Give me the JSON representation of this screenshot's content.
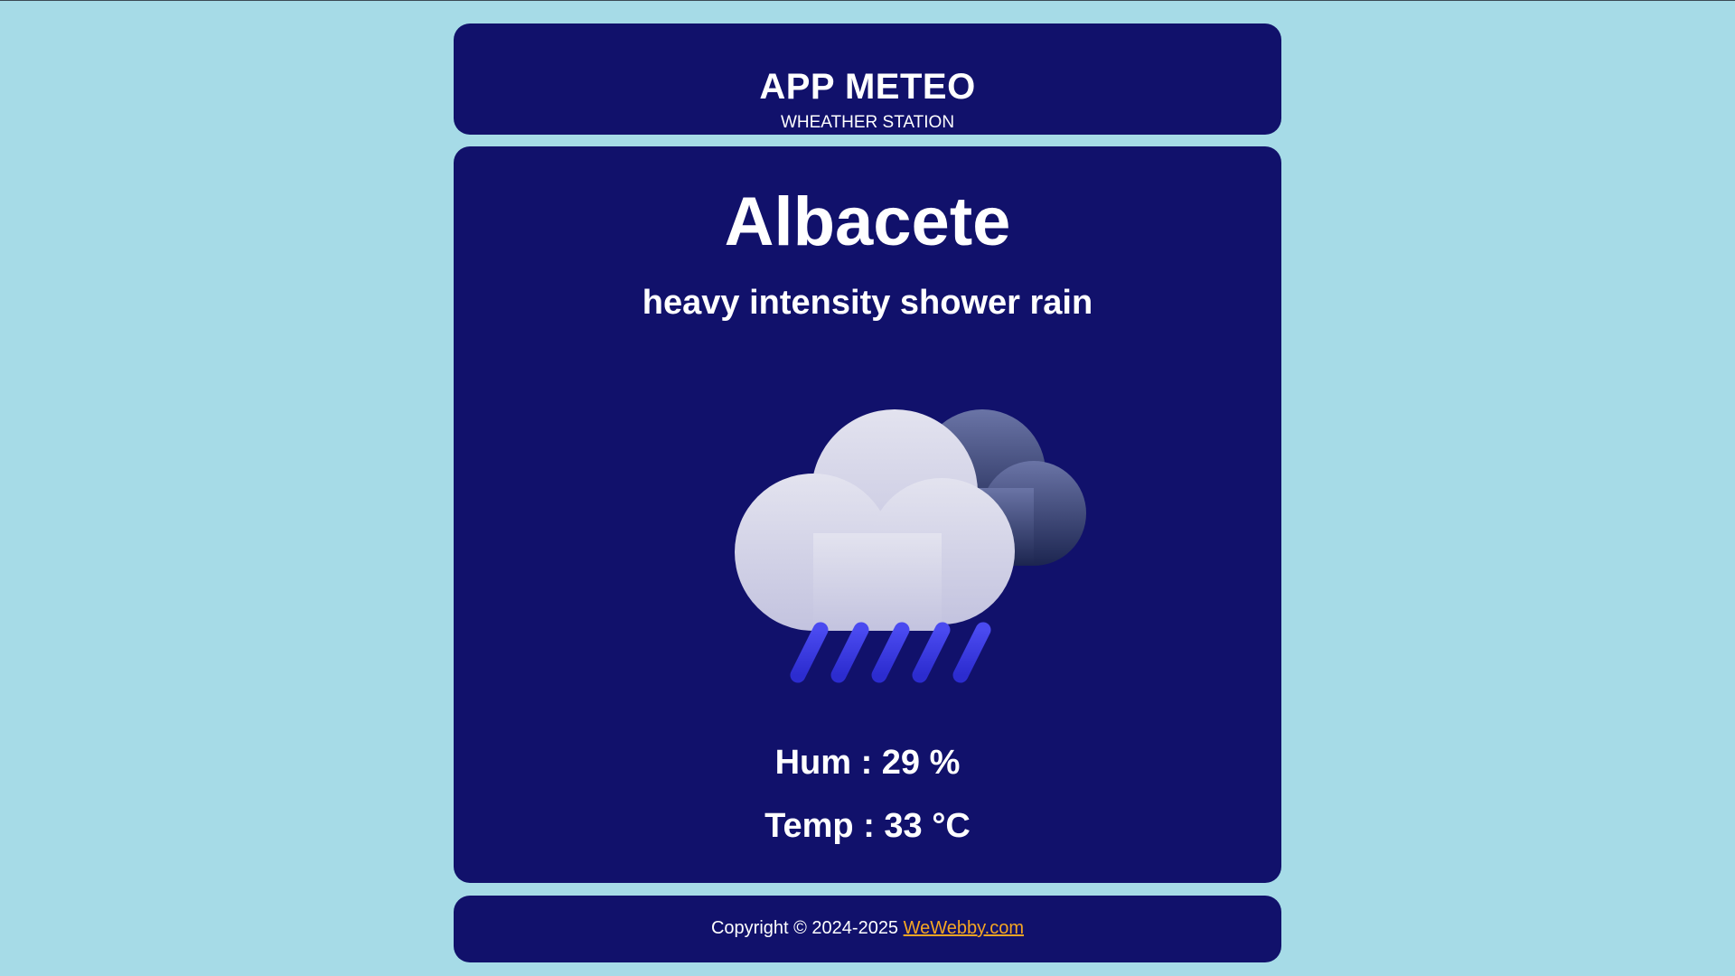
{
  "header": {
    "title": "APP METEO",
    "subtitle": "WHEATHER STATION"
  },
  "weather": {
    "city": "Albacete",
    "description": "heavy intensity shower rain",
    "icon": "heavy-rain-cloud-icon",
    "humidity": "Hum : 29 %",
    "temperature": "Temp : 33 °C"
  },
  "footer": {
    "copyright": "Copyright © 2024-2025",
    "link_label": "WeWebby.com",
    "link_color": "#f5a623"
  },
  "colors": {
    "background": "#a6dbe7",
    "card": "#11116b",
    "text": "#ffffff",
    "rain": "#3a3ae6"
  }
}
